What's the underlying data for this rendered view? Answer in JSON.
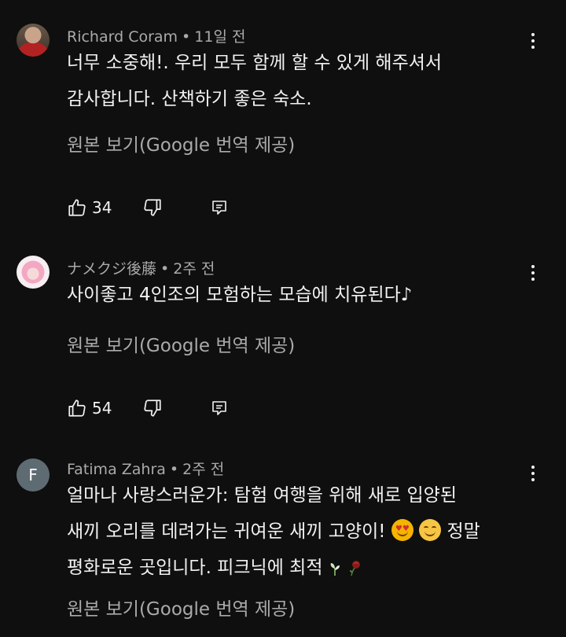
{
  "comments": [
    {
      "author": "Richard Coram",
      "time": "11일 전",
      "lines": [
        "너무 소중해!. 우리 모두 함께 할 수 있게 해주셔서",
        "감사합니다. 산책하기 좋은 숙소."
      ],
      "translate": "원본 보기(Google 번역 제공)",
      "likes": "34",
      "avatar": "photo"
    },
    {
      "author": "ナメクジ後藤",
      "time": "2주 전",
      "lines": [
        "사이좋고 4인조의 모험하는 모습에 치유된다♪"
      ],
      "translate": "원본 보기(Google 번역 제공)",
      "likes": "54",
      "avatar": "photo"
    },
    {
      "author": "Fatima Zahra",
      "time": "2주 전",
      "lines": [
        "얼마나 사랑스러운가: 탐험 여행을 위해 새로 입양된",
        "새끼 오리를 데려가는 귀여운 새끼 고양이!",
        "정말",
        "평화로운 곳입니다. 피크닉에 최적"
      ],
      "translate": "원본 보기(Google 번역 제공)",
      "avatar_letter": "F",
      "avatar_color": "#5f6b73"
    }
  ],
  "icons": {
    "like": "thumbs-up-icon",
    "dislike": "thumbs-down-icon",
    "reply": "reply-icon",
    "menu": "more-vert-icon",
    "emoji1": "smiling-face-heart-eyes-icon",
    "emoji2": "smiling-face-icon",
    "emoji3": "herb-icon",
    "emoji4": "wilted-rose-icon"
  }
}
